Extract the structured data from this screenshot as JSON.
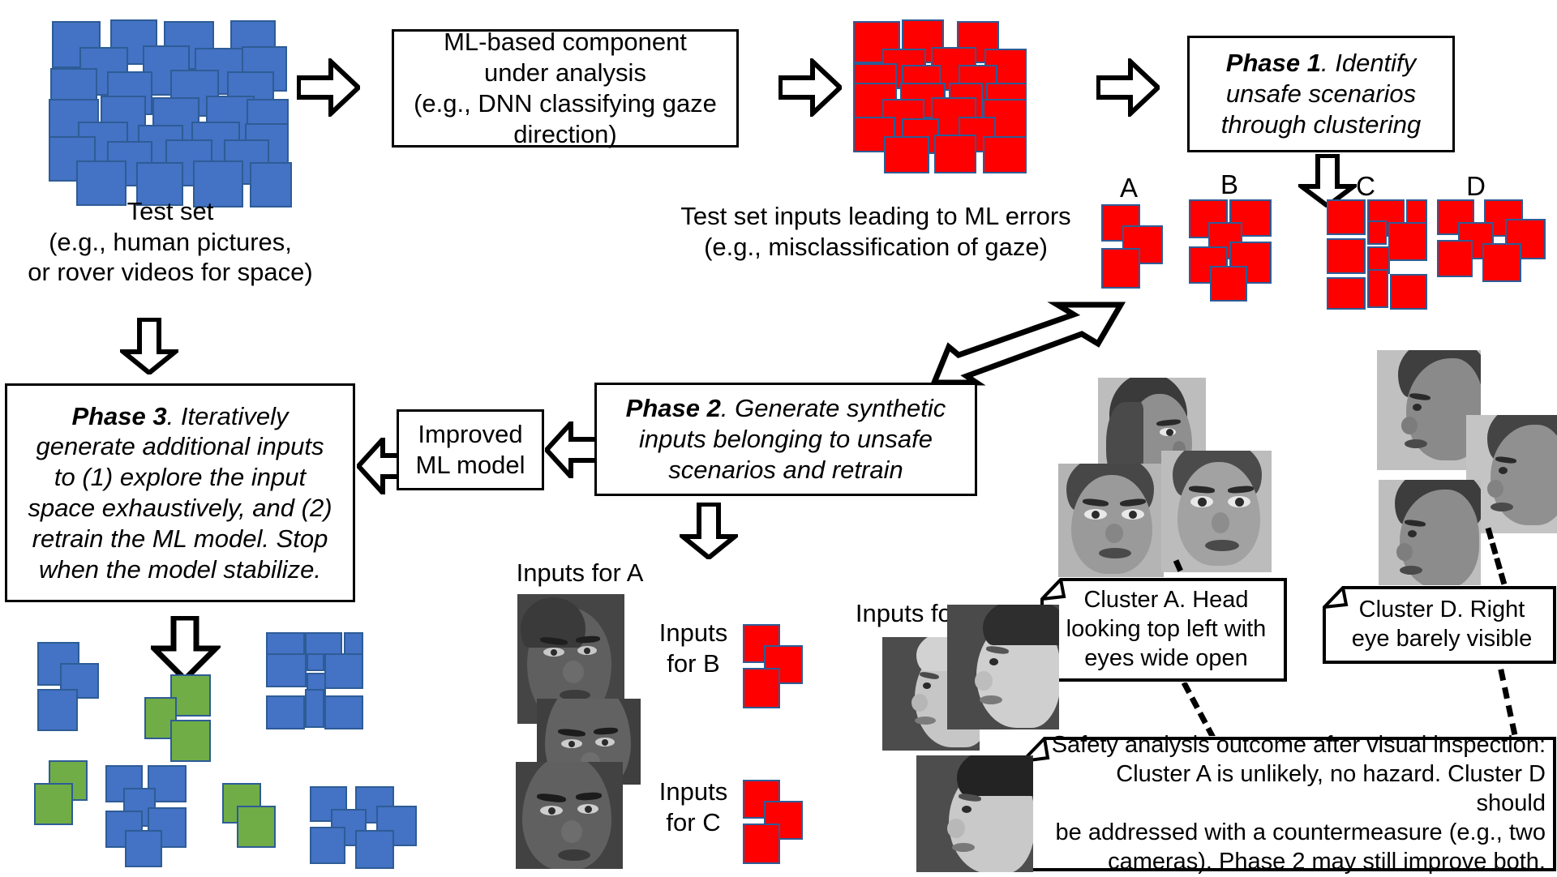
{
  "diagram": {
    "title_absent": true,
    "accent_colors": {
      "blue_square": "#4472C4",
      "red_square": "#FF0000",
      "green_square": "#70AD47",
      "square_border": "#2E5C96",
      "line": "#000000",
      "background": "#FFFFFF"
    }
  },
  "captions": {
    "test_set": "Test set\n(e.g., human pictures,\nor rover videos for space)",
    "ml_errors": "Test set inputs leading to ML errors\n(e.g., misclassification of gaze)",
    "inputs_for_a": "Inputs for A",
    "inputs_for_b": "Inputs\nfor B",
    "inputs_for_c": "Inputs\nfor C",
    "inputs_for_d": "Inputs for D"
  },
  "cluster_labels": {
    "a": "A",
    "b": "B",
    "c": "C",
    "d": "D"
  },
  "boxes": {
    "ml_component": "ML-based component\nunder analysis\n(e.g., DNN classifying gaze\ndirection)",
    "phase1_bold": "Phase 1",
    "phase1_rest": ". Identify\nunsafe scenarios\nthrough clustering",
    "phase2_bold": "Phase 2",
    "phase2_rest": ". Generate synthetic\ninputs belonging to unsafe\nscenarios and retrain",
    "phase3_bold": "Phase 3",
    "phase3_rest": ". Iteratively\ngenerate additional inputs\nto (1) explore the input\nspace exhaustively, and (2)\nretrain the ML model. Stop\nwhen the model stabilize.",
    "improved_model": "Improved\nML model"
  },
  "notes": {
    "cluster_a": "Cluster A. Head\nlooking top left with\neyes wide open",
    "cluster_d": "Cluster D. Right\neye barely visible",
    "safety_analysis": "Safety analysis outcome after visual inspection:\nCluster A is unlikely, no hazard. Cluster D should\nbe addressed with a countermeasure (e.g., two\ncameras). Phase 2 may still improve both."
  },
  "arrows": {
    "a1": "block-arrow-right",
    "a2": "block-arrow-right",
    "a3": "block-arrow-right",
    "a4": "block-arrow-down",
    "a5": "block-arrow-down-left-large",
    "a6": "block-arrow-left",
    "a7": "block-arrow-left",
    "a8": "block-arrow-down",
    "a9": "block-arrow-down",
    "a10": "block-arrow-down"
  }
}
